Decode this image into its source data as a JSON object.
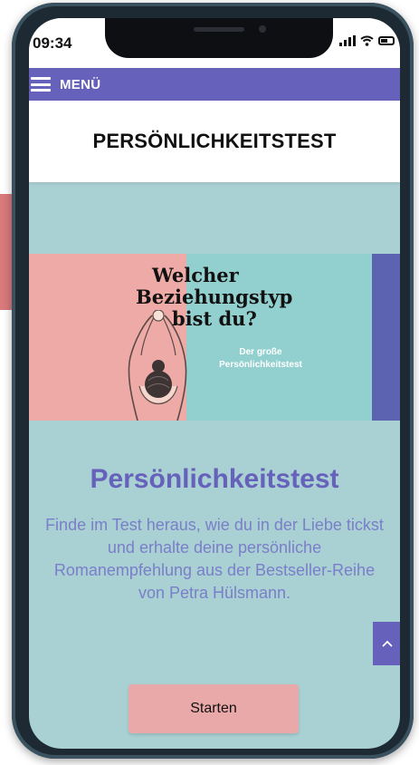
{
  "status_bar": {
    "time": "09:34"
  },
  "menu": {
    "label": "MENÜ"
  },
  "header": {
    "title": "PERSÖNLICHKEITSTEST"
  },
  "hero": {
    "title_lines": [
      "Welcher",
      "Beziehungstyp",
      "bist du?"
    ],
    "subtitle_lines": [
      "Der große",
      "Persönlichkeitstest"
    ],
    "colors": {
      "left": "#eeaaa6",
      "middle": "#92d0cf",
      "right": "#5c63b0"
    }
  },
  "content": {
    "headline": "Persönlichkeitstest",
    "description": "Finde im Test heraus, wie du in der Liebe tickst und erhalte deine persönliche Romanempfehlung aus der Bestseller-Reihe von Petra Hülsmann."
  },
  "actions": {
    "start_label": "Starten",
    "scroll_top_icon": "chevron-up-icon"
  },
  "colors": {
    "accent": "#6661ba",
    "page_background": "#a9d0d3",
    "button": "#eaa9a9",
    "description_text": "#7b7ec9"
  }
}
